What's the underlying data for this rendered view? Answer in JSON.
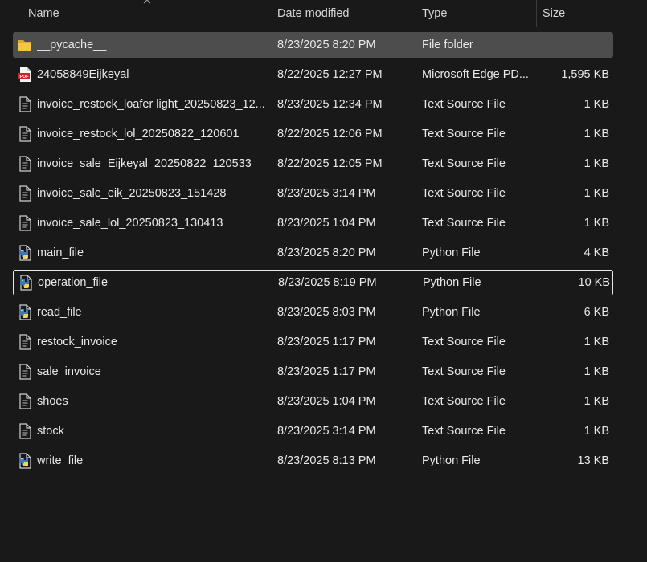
{
  "columns": {
    "name": "Name",
    "date": "Date modified",
    "type": "Type",
    "size": "Size"
  },
  "files": [
    {
      "name": "__pycache__",
      "date": "8/23/2025 8:20 PM",
      "type": "File folder",
      "size": "",
      "icon": "folder-icon"
    },
    {
      "name": "24058849Eijkeyal",
      "date": "8/22/2025 12:27 PM",
      "type": "Microsoft Edge PD...",
      "size": "1,595 KB",
      "icon": "pdf-icon"
    },
    {
      "name": "invoice_restock_loafer light_20250823_12...",
      "date": "8/23/2025 12:34 PM",
      "type": "Text Source File",
      "size": "1 KB",
      "icon": "text-file-icon"
    },
    {
      "name": "invoice_restock_lol_20250822_120601",
      "date": "8/22/2025 12:06 PM",
      "type": "Text Source File",
      "size": "1 KB",
      "icon": "text-file-icon"
    },
    {
      "name": "invoice_sale_Eijkeyal_20250822_120533",
      "date": "8/22/2025 12:05 PM",
      "type": "Text Source File",
      "size": "1 KB",
      "icon": "text-file-icon"
    },
    {
      "name": "invoice_sale_eik_20250823_151428",
      "date": "8/23/2025 3:14 PM",
      "type": "Text Source File",
      "size": "1 KB",
      "icon": "text-file-icon"
    },
    {
      "name": "invoice_sale_lol_20250823_130413",
      "date": "8/23/2025 1:04 PM",
      "type": "Text Source File",
      "size": "1 KB",
      "icon": "text-file-icon"
    },
    {
      "name": "main_file",
      "date": "8/23/2025 8:20 PM",
      "type": "Python File",
      "size": "4 KB",
      "icon": "python-file-icon"
    },
    {
      "name": "operation_file",
      "date": "8/23/2025 8:19 PM",
      "type": "Python File",
      "size": "10 KB",
      "icon": "python-file-icon"
    },
    {
      "name": "read_file",
      "date": "8/23/2025 8:03 PM",
      "type": "Python File",
      "size": "6 KB",
      "icon": "python-file-icon"
    },
    {
      "name": "restock_invoice",
      "date": "8/23/2025 1:17 PM",
      "type": "Text Source File",
      "size": "1 KB",
      "icon": "text-file-icon"
    },
    {
      "name": "sale_invoice",
      "date": "8/23/2025 1:17 PM",
      "type": "Text Source File",
      "size": "1 KB",
      "icon": "text-file-icon"
    },
    {
      "name": "shoes",
      "date": "8/23/2025 1:04 PM",
      "type": "Text Source File",
      "size": "1 KB",
      "icon": "text-file-icon"
    },
    {
      "name": "stock",
      "date": "8/23/2025 3:14 PM",
      "type": "Text Source File",
      "size": "1 KB",
      "icon": "text-file-icon"
    },
    {
      "name": "write_file",
      "date": "8/23/2025 8:13 PM",
      "type": "Python File",
      "size": "13 KB",
      "icon": "python-file-icon"
    }
  ],
  "selected_row": "__pycache__",
  "focused_row": "operation_file",
  "colors": {
    "background": "#191919",
    "selected": "#4d4d4d",
    "folder": "#f4c040",
    "pdf": "#c62828",
    "python_blue": "#3e78b4",
    "python_yellow": "#f7d34a"
  }
}
